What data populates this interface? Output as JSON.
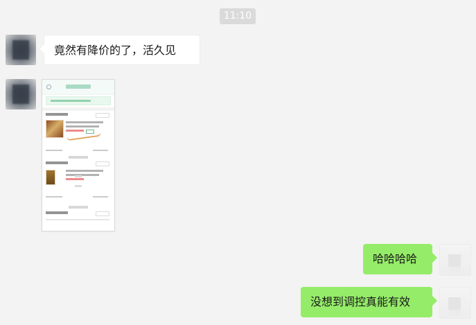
{
  "chat": {
    "timestamp": "11:10",
    "messages": [
      {
        "side": "left",
        "text": "竟然有降价的了，活久见"
      },
      {
        "side": "left",
        "type": "image"
      },
      {
        "side": "right",
        "text": "哈哈哈哈"
      },
      {
        "side": "right",
        "text": "没想到调控真能有效"
      }
    ]
  },
  "colors": {
    "background": "#f3f3f3",
    "left_bubble": "#ffffff",
    "right_bubble": "#95ec69",
    "timestamp_bg": "#dadada"
  },
  "icons": {
    "left_avatar": "blurred-avatar",
    "right_avatar": "blurred-avatar",
    "shared_image": "screenshot-thumbnail"
  }
}
